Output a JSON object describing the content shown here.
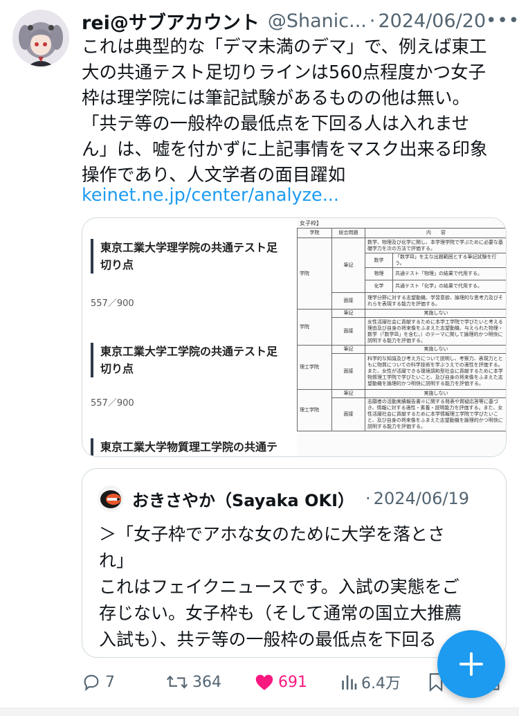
{
  "tweet": {
    "display_name": "rei@サブアカウント",
    "handle": "@Shanic...",
    "separator": "·",
    "date": "2024/06/20",
    "more_label": "•••",
    "lines": [
      "これは典型的な「デマ未満のデマ」で、例えば東工",
      "大の共通テスト足切りラインは560点程度かつ女子",
      "枠は理学院には筆記試験があるものの他は無い。",
      "「共テ等の一般枠の最低点を下回る人は入れませ",
      "ん」は、嘘を付かずに上記事情をマスク出来る印象",
      "操作であり、人文学者の面目躍如"
    ],
    "link": "keinet.ne.jp/center/analyze..."
  },
  "media": {
    "scores": [
      {
        "title": "東京工業大学理学院の共通テスト足切り点",
        "value": "557／900"
      },
      {
        "title": "東京工業大学工学院の共通テスト足切り点",
        "value": "557／900"
      },
      {
        "title": "東京工業大学物質理工学院の共通テ",
        "value": ""
      }
    ],
    "table": {
      "label": "女子枠】",
      "headers": [
        "学院",
        "総合問題",
        "内　　容"
      ],
      "r1_school": "学院",
      "r1_type": "筆記",
      "r1_desc": "数学、物理及び化学に関し、本学理学院で学ぶために必要な基礎学力を次の方法で評価する。",
      "r1_sub1_name": "数学",
      "r1_sub1_text": "「数学Ⅲ」を主な出題範囲とする筆記試験を行う。",
      "r1_sub2_name": "物理",
      "r1_sub2_text": "共通テスト「物理」の結果で代用する。",
      "r1_sub3_name": "化学",
      "r1_sub3_text": "共通テスト「化学」の結果で代用する。",
      "r1_interview": "面接",
      "r1_interview_text": "理学分野に対する志望動機、学習意欲、論理的な思考力及びそれらを表現する能力を評価する。",
      "r2_school": "学院",
      "r2_written": "筆記",
      "r2_written_text": "実施しない",
      "r2_interview": "面接",
      "r2_interview_text": "女性活躍社会に貢献するために本学工学院で学びたいと考える理由及び自身の将来像をふまえた志望動機、与えられた物理・数学（「数学Ⅲ」を含む。）のテーマに関して論理的かつ明快に説明する能力を評価する。",
      "r3_school": "理工学院",
      "r3_written": "筆記",
      "r3_written_text": "実施しない",
      "r3_interview": "面接",
      "r3_interview_text": "科学的な知識及び考え方について説明し、考察力、表現力とともに物質についての科学技術を学ぶうえでの適性を評価する。また、女性が活躍できる環境調和型社会に貢献するために本学物質理工学院で学びたいこと、及び自身の将来像をふまえた志望動機を論理的かつ明快に説明する能力を評価する。",
      "r4_school": "理工学院",
      "r4_written": "筆記",
      "r4_written_text": "実施しない",
      "r4_interview": "面接",
      "r4_interview_text": "志願者の活動実績報告書※に関する発表や質疑応答等に基づき、情報に対する適性・素養・説明能力を評価する。また、女性活躍社会に貢献するために本学情報理工学院で学びたいこと、及び自身の将来像をふまえた志望動機を論理的かつ明快に説明する能力を評価する。"
    }
  },
  "quote": {
    "display_name": "おきさやか（Sayaka OKI）",
    "separator": "·",
    "date": "2024/06/19",
    "lines": [
      "＞「女子枠でアホな女のために大学を落とさ",
      "れ」",
      "これはフェイクニュースです。入試の実態をご",
      "存じない。女子枠も（そして通常の国立大推薦",
      "入試も）、共テ等の一般枠の最低点を下回る"
    ]
  },
  "actions": {
    "replies": "7",
    "retweets": "364",
    "likes": "691",
    "views": "6.4万"
  },
  "colors": {
    "link": "#1d9bf0",
    "like": "#f91880",
    "muted": "#536471",
    "fab": "#1d9bf0"
  },
  "icons": {
    "reply": "speech-bubble-icon",
    "retweet": "retweet-icon",
    "like": "heart-filled-icon",
    "views": "bar-chart-icon",
    "bookmark": "bookmark-icon",
    "share": "share-icon",
    "fab": "plus-icon"
  }
}
